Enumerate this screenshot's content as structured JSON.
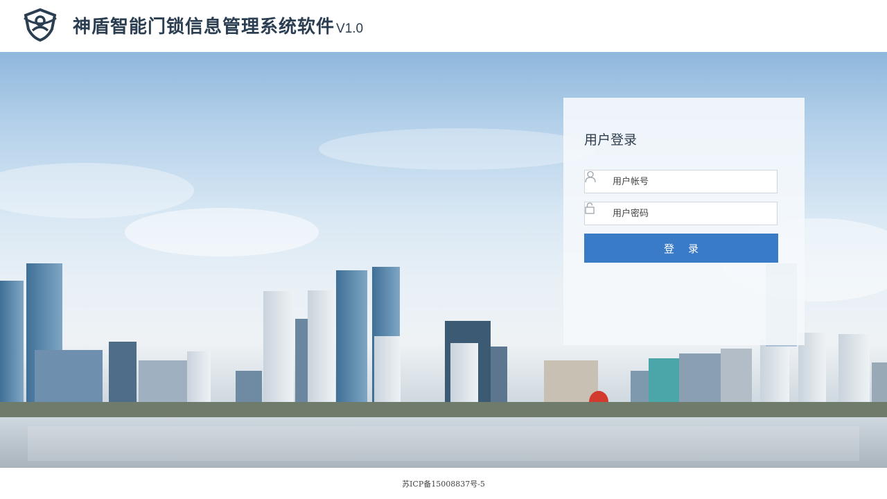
{
  "header": {
    "logo": "shield-person-logo",
    "title": "神盾智能门锁信息管理系统软件",
    "version": "V1.0"
  },
  "banner": {
    "image": "city-skyline-waterfront"
  },
  "login": {
    "title": "用户登录",
    "username_placeholder": "用户帐号",
    "password_placeholder": "用户密码",
    "username_icon": "user-icon",
    "password_icon": "lock-icon",
    "submit_label": "登录"
  },
  "footer": {
    "icp": "苏ICP备15008837号-5"
  },
  "colors": {
    "accent": "#3a7bc8",
    "title_text": "#2b3e51"
  }
}
